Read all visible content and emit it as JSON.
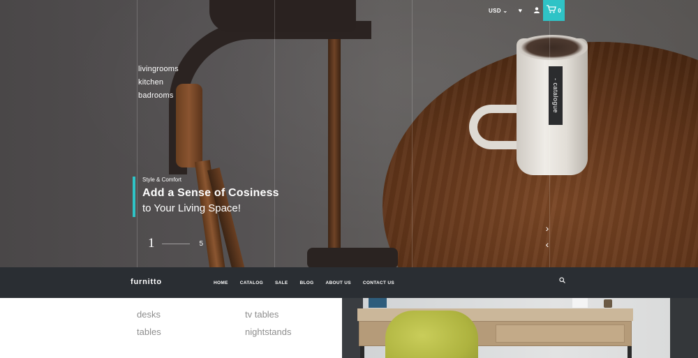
{
  "topbar": {
    "currency": "USD",
    "cart_count": "0"
  },
  "hero": {
    "categories": [
      "livingrooms",
      "kitchen",
      "badrooms"
    ],
    "catalogue_tab": "- catalogue",
    "eyebrow": "Style & Comfort",
    "headline": "Add a Sense of Cosiness",
    "subline": "to Your Living Space!",
    "slide_current": "1",
    "slide_total": "5",
    "accent_color": "#2fc3c6"
  },
  "nav": {
    "logo": "furnitto",
    "links": [
      "HOME",
      "CATALOG",
      "SALE",
      "BLOG",
      "ABOUT US",
      "CONTACT US"
    ]
  },
  "lower": {
    "col1": [
      "desks",
      "tables"
    ],
    "col2": [
      "tv tables",
      "nightstands"
    ]
  },
  "icons": {
    "currency_dropdown": "chevron-down-icon",
    "wishlist": "heart-icon",
    "account": "user-icon",
    "cart": "cart-icon",
    "next": "chevron-right-icon",
    "prev": "chevron-left-icon",
    "search": "search-icon"
  }
}
